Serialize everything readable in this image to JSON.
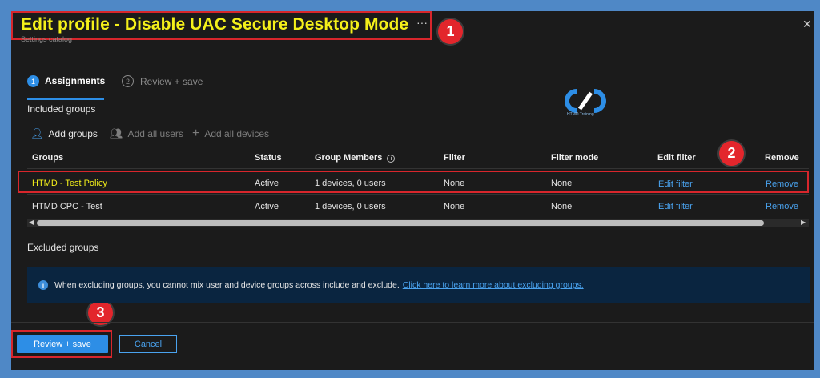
{
  "header": {
    "title": "Edit profile - Disable UAC Secure Desktop Mode",
    "more": "···",
    "subtitle": "Settings catalog",
    "close": "✕"
  },
  "callouts": [
    "1",
    "2",
    "3"
  ],
  "steps": [
    {
      "num": "1",
      "label": "Assignments"
    },
    {
      "num": "2",
      "label": "Review + save"
    }
  ],
  "logo": {
    "text": "HTMD Training",
    "color": "#2d8ee6"
  },
  "included": {
    "label": "Included groups",
    "commands": {
      "add_groups": "Add groups",
      "add_all_users": "Add all users",
      "add_all_devices": "Add all devices"
    },
    "columns": [
      "Groups",
      "Status",
      "Group Members",
      "Filter",
      "Filter mode",
      "Edit filter",
      "Remove"
    ],
    "rows": [
      {
        "group": "HTMD - Test Policy",
        "status": "Active",
        "members": "1 devices, 0 users",
        "filter": "None",
        "filter_mode": "None",
        "edit_filter": "Edit filter",
        "remove": "Remove"
      },
      {
        "group": "HTMD CPC - Test",
        "status": "Active",
        "members": "1 devices, 0 users",
        "filter": "None",
        "filter_mode": "None",
        "edit_filter": "Edit filter",
        "remove": "Remove"
      }
    ]
  },
  "excluded": {
    "label": "Excluded groups",
    "info_text": "When excluding groups, you cannot mix user and device groups across include and exclude.",
    "info_link": "Click here to learn more about excluding groups."
  },
  "footer": {
    "primary": "Review + save",
    "secondary": "Cancel"
  },
  "colors": {
    "accent": "#2d8ee6",
    "highlight": "#d8262c",
    "title": "#f4f01a"
  }
}
